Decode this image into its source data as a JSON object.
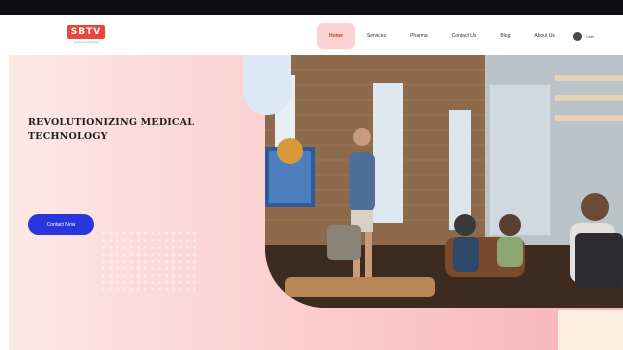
{
  "brand": {
    "logo_text": "SBTV",
    "logo_sub": "medical technology"
  },
  "nav": {
    "items": [
      {
        "label": "Home",
        "active": true
      },
      {
        "label": "Services",
        "active": false
      },
      {
        "label": "Pharma",
        "active": false
      },
      {
        "label": "Contact Us",
        "active": false
      },
      {
        "label": "Blog",
        "active": false
      },
      {
        "label": "About Us",
        "active": false
      }
    ],
    "user_label": "User"
  },
  "hero": {
    "title": "REVOLUTIONIZING MEDICAL TECHNOLOGY",
    "description": "",
    "cta_label": "Contact Now"
  },
  "colors": {
    "accent": "#2a36d9",
    "nav_active_bg": "#fbd3d3",
    "hero_gradient_start": "#fde9e6",
    "hero_gradient_end": "#f8b4b8",
    "logo_red": "#e8473d"
  },
  "icons": {
    "user_avatar": "user-avatar-icon"
  }
}
